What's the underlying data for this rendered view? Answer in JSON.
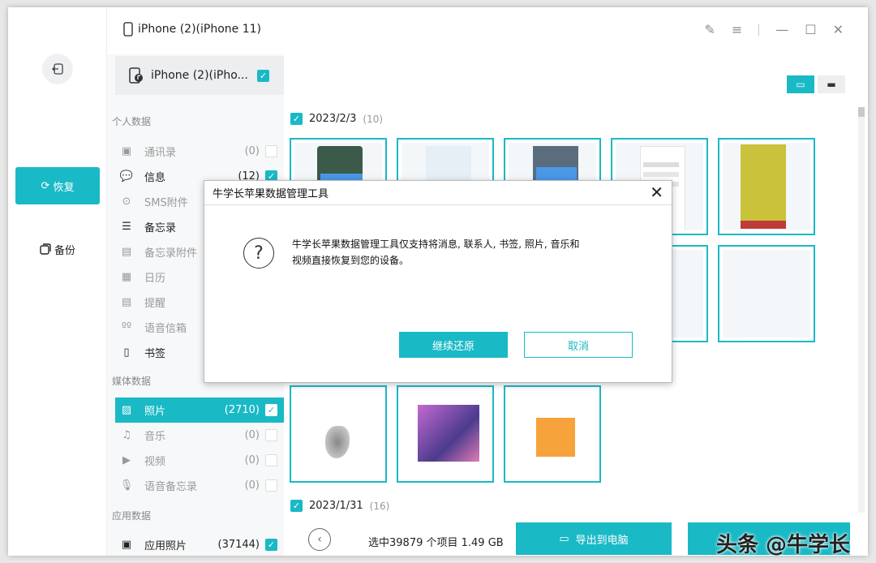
{
  "header": {
    "device_title": "iPhone (2)(iPhone 11)"
  },
  "rail": {
    "restore_label": "恢复",
    "backup_label": "备份"
  },
  "sidebar": {
    "device_name": "iPhone (2)(iPho...",
    "personal_section": "个人数据",
    "personal_items": [
      {
        "label": "通讯录",
        "count": "(0)",
        "checked": false,
        "active": false
      },
      {
        "label": "信息",
        "count": "(12)",
        "checked": true,
        "active": true
      },
      {
        "label": "SMS附件",
        "count": "",
        "checked": false,
        "active": false
      },
      {
        "label": "备忘录",
        "count": "",
        "checked": false,
        "active": true
      },
      {
        "label": "备忘录附件",
        "count": "",
        "checked": false,
        "active": false
      },
      {
        "label": "日历",
        "count": "",
        "checked": false,
        "active": false
      },
      {
        "label": "提醒",
        "count": "",
        "checked": false,
        "active": false
      },
      {
        "label": "语音信箱",
        "count": "",
        "checked": false,
        "active": false
      },
      {
        "label": "书签",
        "count": "",
        "checked": false,
        "active": true
      }
    ],
    "media_section": "媒体数据",
    "media_items": [
      {
        "label": "照片",
        "count": "(2710)",
        "checked": true,
        "selected": true
      },
      {
        "label": "音乐",
        "count": "(0)",
        "checked": false
      },
      {
        "label": "视频",
        "count": "(0)",
        "checked": false
      },
      {
        "label": "语音备忘录",
        "count": "(0)",
        "checked": false
      }
    ],
    "app_section": "应用数据",
    "app_items": [
      {
        "label": "应用照片",
        "count": "(37144)",
        "checked": true
      }
    ]
  },
  "main": {
    "group1_date": "2023/2/3",
    "group1_count": "(10)",
    "group2_date": "2023/1/31",
    "group2_count": "(16)",
    "summary": "选中39879 个项目 1.49 GB",
    "export_label": "导出到电脑"
  },
  "modal": {
    "title": "牛学长苹果数据管理工具",
    "message_line1": "牛学长苹果数据管理工具仅支持将消息, 联系人, 书签, 照片, 音乐和",
    "message_line2": "视频直接恢复到您的设备。",
    "ok_label": "继续还原",
    "cancel_label": "取消"
  },
  "watermark": "头条 @牛学长",
  "colors": {
    "accent": "#1ab9c6"
  }
}
